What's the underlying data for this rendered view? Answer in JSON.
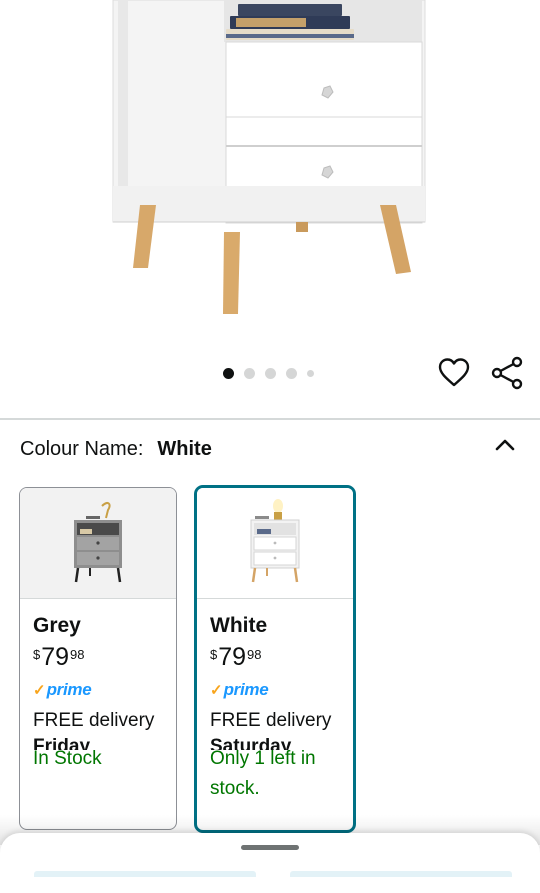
{
  "product": {
    "carousel": {
      "total_images": 5,
      "active_index": 0
    },
    "icons": {
      "wishlist": "heart-icon",
      "share": "share-icon"
    }
  },
  "variation": {
    "label": "Colour Name:",
    "selected_value": "White",
    "collapse_icon": "chevron-up-icon",
    "options": [
      {
        "name": "Grey",
        "currency": "$",
        "price_whole": "79",
        "price_fraction": "98",
        "prime": "prime",
        "delivery": "FREE delivery",
        "delivery_day": "Friday",
        "stock": "In Stock",
        "selected": false
      },
      {
        "name": "White",
        "currency": "$",
        "price_whole": "79",
        "price_fraction": "98",
        "prime": "prime",
        "delivery": "FREE delivery",
        "delivery_day": "Saturday",
        "stock": "Only 1 left in stock.",
        "selected": true
      }
    ]
  },
  "colors": {
    "accent_selected_border": "#007185",
    "prime_blue": "#1a98ff",
    "prime_check": "#f8a51d",
    "in_stock_green": "#007600"
  }
}
